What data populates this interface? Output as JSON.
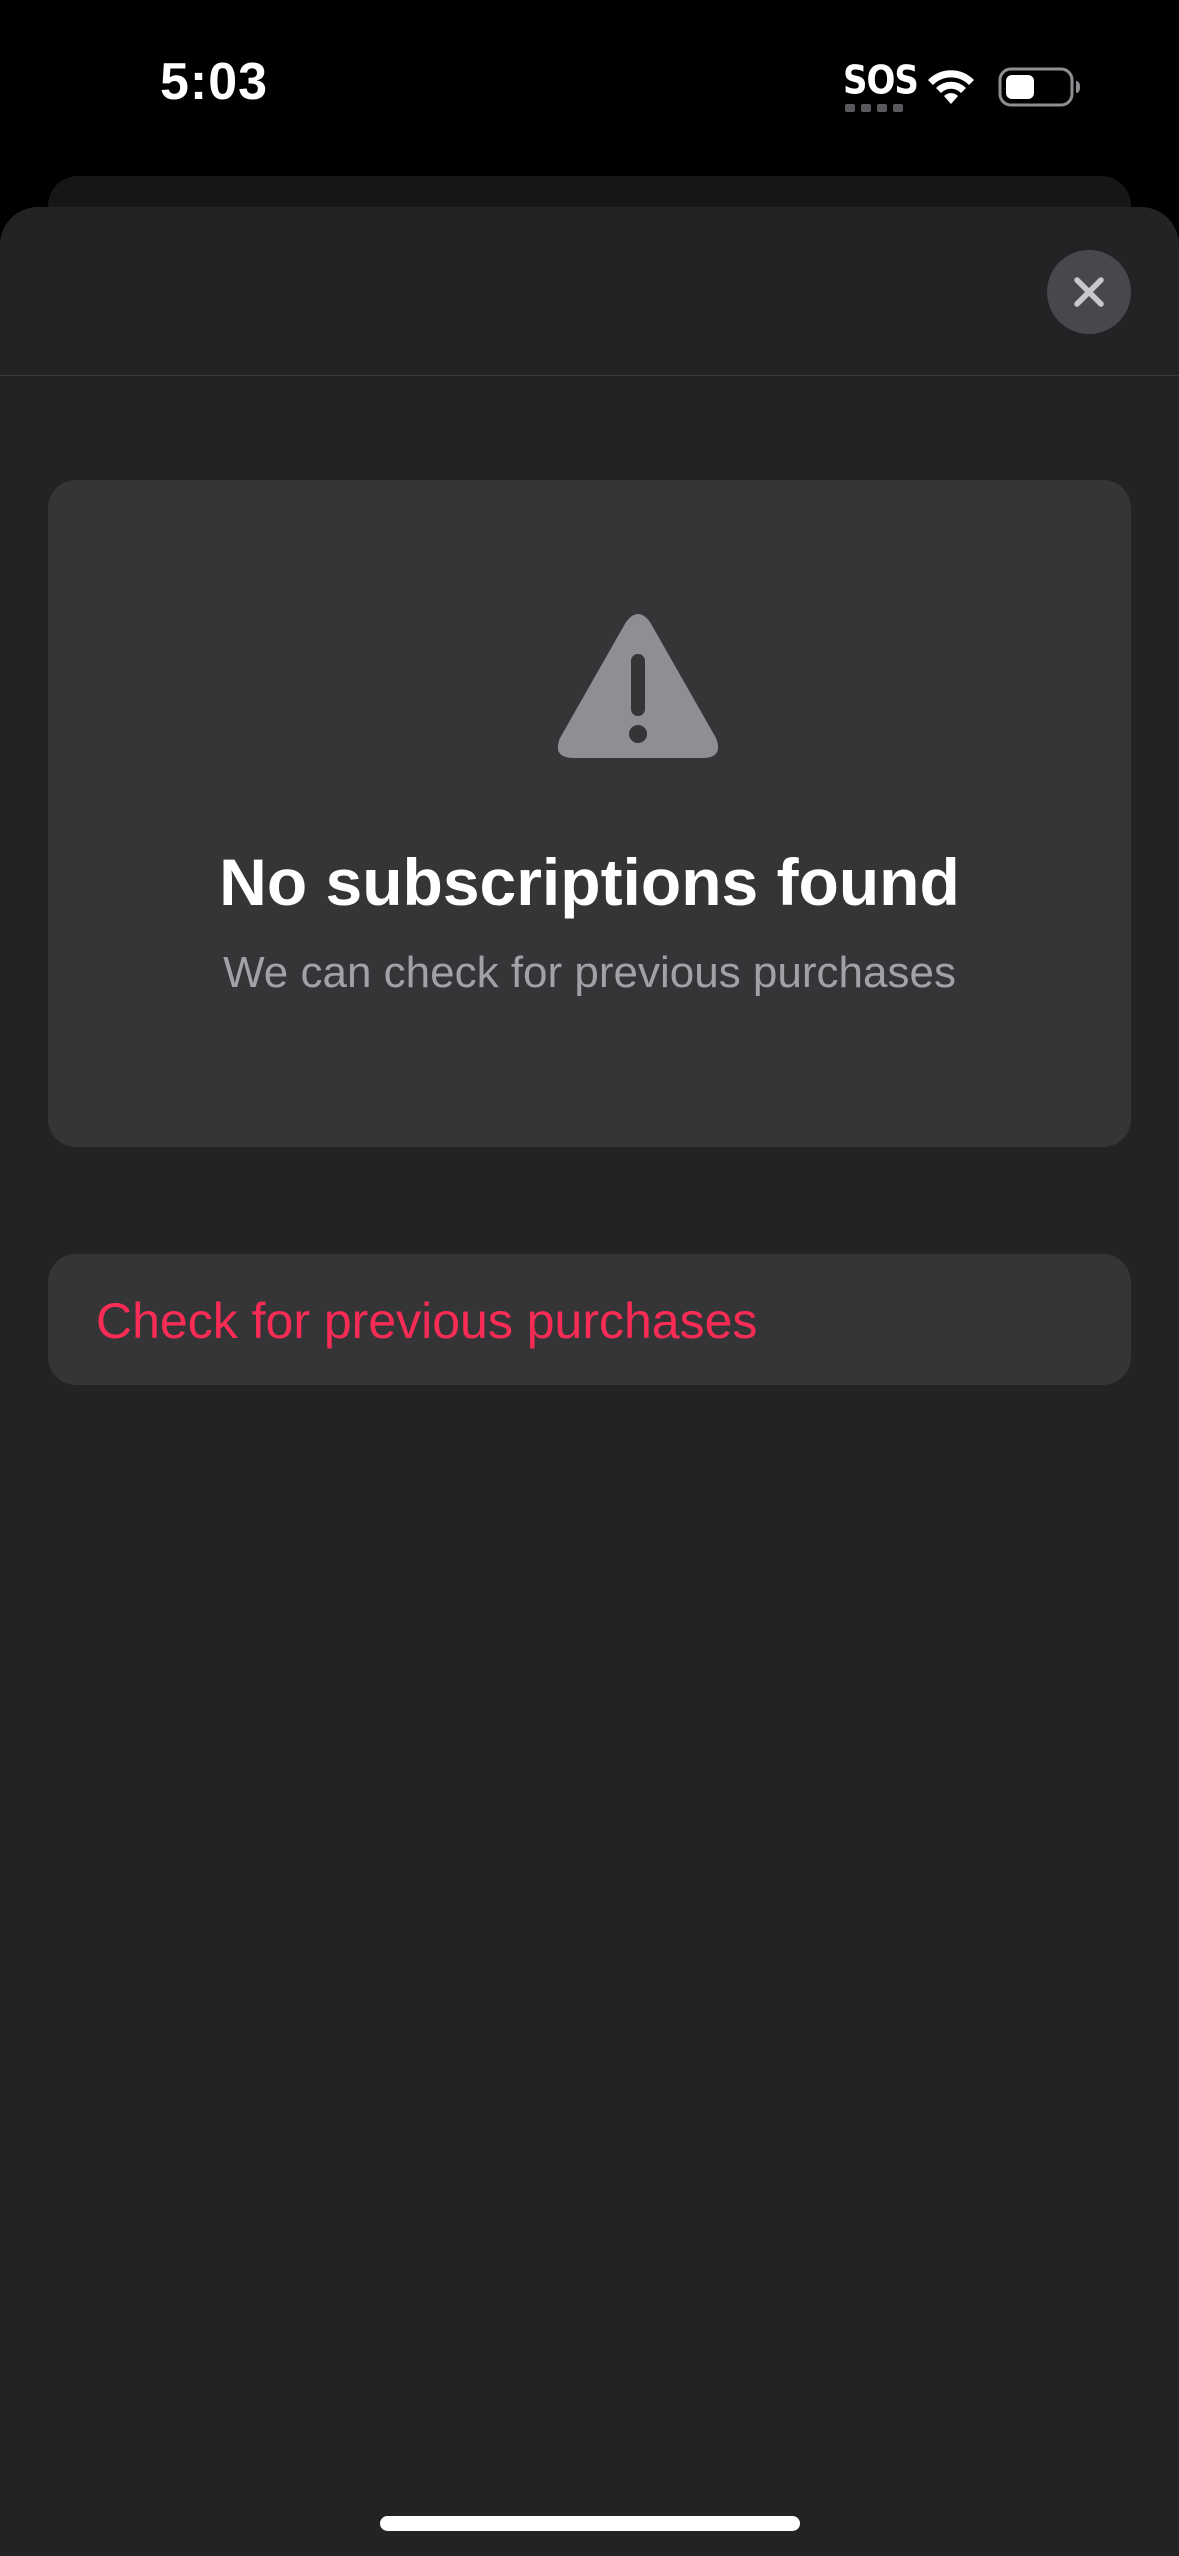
{
  "status_bar": {
    "time": "5:03",
    "sos_label": "SOS",
    "icons": [
      "wifi-icon",
      "battery-icon"
    ]
  },
  "sheet": {
    "close_icon": "close-icon",
    "empty_state": {
      "icon": "warning-triangle-icon",
      "title": "No subscriptions found",
      "subtitle": "We can check for previous purchases"
    },
    "check_button_label": "Check for previous purchases"
  },
  "colors": {
    "accent": "#fa2c55",
    "sheet_background": "#232325",
    "card_background": "#353538",
    "secondary_text": "#a1a1a6",
    "icon_gray": "#8e8e93"
  }
}
